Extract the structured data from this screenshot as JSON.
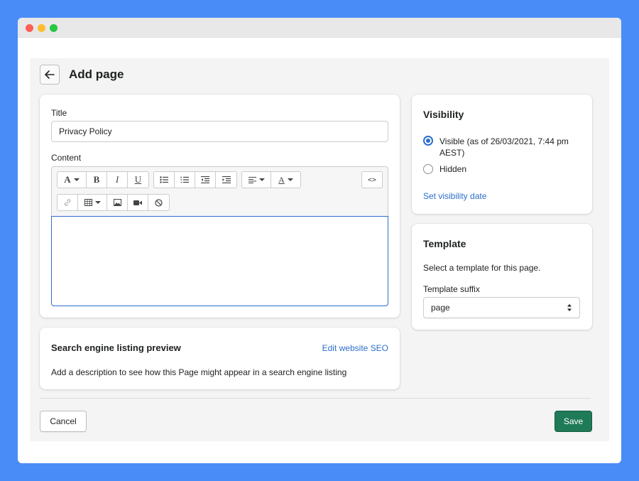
{
  "header": {
    "title": "Add page"
  },
  "content_card": {
    "title_label": "Title",
    "title_value": "Privacy Policy",
    "content_label": "Content",
    "toolbar": {
      "font_icon": "A",
      "bold_icon": "B",
      "italic_icon": "I",
      "underline_icon": "U",
      "text_color_icon": "A",
      "html_toggle": "<>"
    }
  },
  "seo_card": {
    "heading": "Search engine listing preview",
    "edit_link": "Edit website SEO",
    "description": "Add a description to see how this Page might appear in a search engine listing"
  },
  "visibility_card": {
    "heading": "Visibility",
    "options": [
      {
        "label": "Visible (as of 26/03/2021, 7:44 pm",
        "label_line2": "AEST)",
        "checked": true
      },
      {
        "label": "Hidden",
        "checked": false
      }
    ],
    "set_date_link": "Set visibility date"
  },
  "template_card": {
    "heading": "Template",
    "description": "Select a template for this page.",
    "suffix_label": "Template suffix",
    "suffix_value": "page"
  },
  "footer": {
    "cancel_label": "Cancel",
    "save_label": "Save"
  },
  "colors": {
    "background": "#4a8cf7",
    "primary_button": "#1f7a58",
    "link": "#2c6ecb",
    "focus_border": "#2c6ecb"
  },
  "icons": [
    "back-arrow-icon",
    "bullet-list-icon",
    "numbered-list-icon",
    "outdent-icon",
    "indent-icon",
    "align-left-icon",
    "link-icon",
    "table-icon",
    "image-icon",
    "video-icon",
    "clear-format-icon",
    "select-arrows-icon"
  ]
}
